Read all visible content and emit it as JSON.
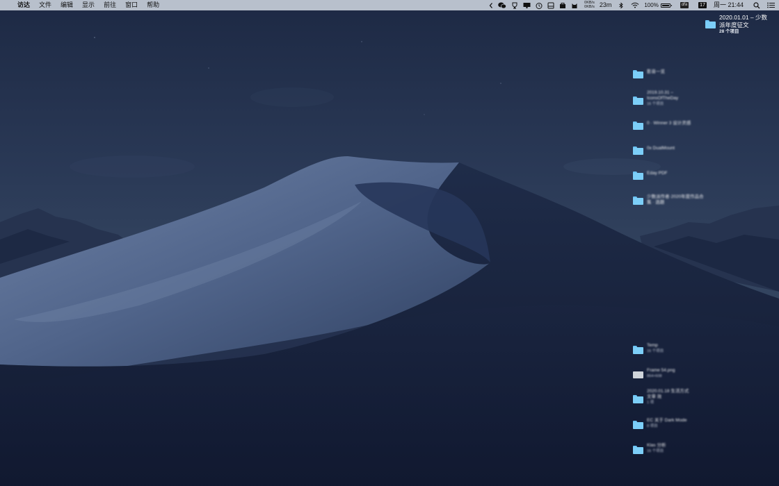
{
  "menubar": {
    "apple_glyph": "",
    "app_name": "访达",
    "menus": [
      "文件",
      "编辑",
      "显示",
      "前往",
      "窗口",
      "帮助"
    ],
    "net_up": "0KB/s",
    "net_down": "0KB/s",
    "timer": "23m",
    "battery_percent": "100%",
    "df_label": "dfa",
    "calendar_day": "17",
    "datetime": "周一 21:44",
    "status_icons": [
      "chevron-left-icon",
      "wechat-icon",
      "trophy-icon",
      "monitor-icon",
      "clock-icon",
      "note-icon",
      "bag-icon",
      "cat-icon",
      "bluetooth-icon",
      "wifi-icon",
      "battery-icon",
      "search-icon",
      "list-icon"
    ]
  },
  "desktop": {
    "top_folder": {
      "name_line1": "2020.01.01 – 少数",
      "name_line2": "派年度征文",
      "subtitle": "28 个项目"
    },
    "items_upper": [
      {
        "type": "folder",
        "name": "影音一览",
        "sub": ""
      },
      {
        "type": "folder",
        "name": "2019.10.31 –",
        "name2": "IconsOfTheDay",
        "sub": "16 个项目"
      },
      {
        "type": "folder",
        "name": "0 · Winner 3 设计灵感",
        "sub": ""
      },
      {
        "type": "folder",
        "name": "0x DualMount",
        "sub": ""
      },
      {
        "type": "folder",
        "name": "Eday PDF",
        "sub": ""
      },
      {
        "type": "folder",
        "name": "少数派作者·2020年度作品合",
        "name2": "集 · 选题",
        "sub": ""
      }
    ],
    "items_lower": [
      {
        "type": "folder",
        "name": "Temp",
        "sub": "16 个项目"
      },
      {
        "type": "file",
        "name": "Frame 54.png",
        "sub": "864×608"
      },
      {
        "type": "folder",
        "name": "2020.01.18 生活方式",
        "name2": "文章 效",
        "sub": "1 项"
      },
      {
        "type": "folder",
        "name": "EC 关于 Dark Mode",
        "sub": "8 项目"
      },
      {
        "type": "folder",
        "name": "Klas 分析",
        "sub": "16 个项目"
      }
    ]
  },
  "colors": {
    "menubar_bg": "#b8c0cc",
    "folder": "#7ccef8",
    "wallpaper_sky": "#22304d",
    "wallpaper_dune": "#16203a"
  }
}
